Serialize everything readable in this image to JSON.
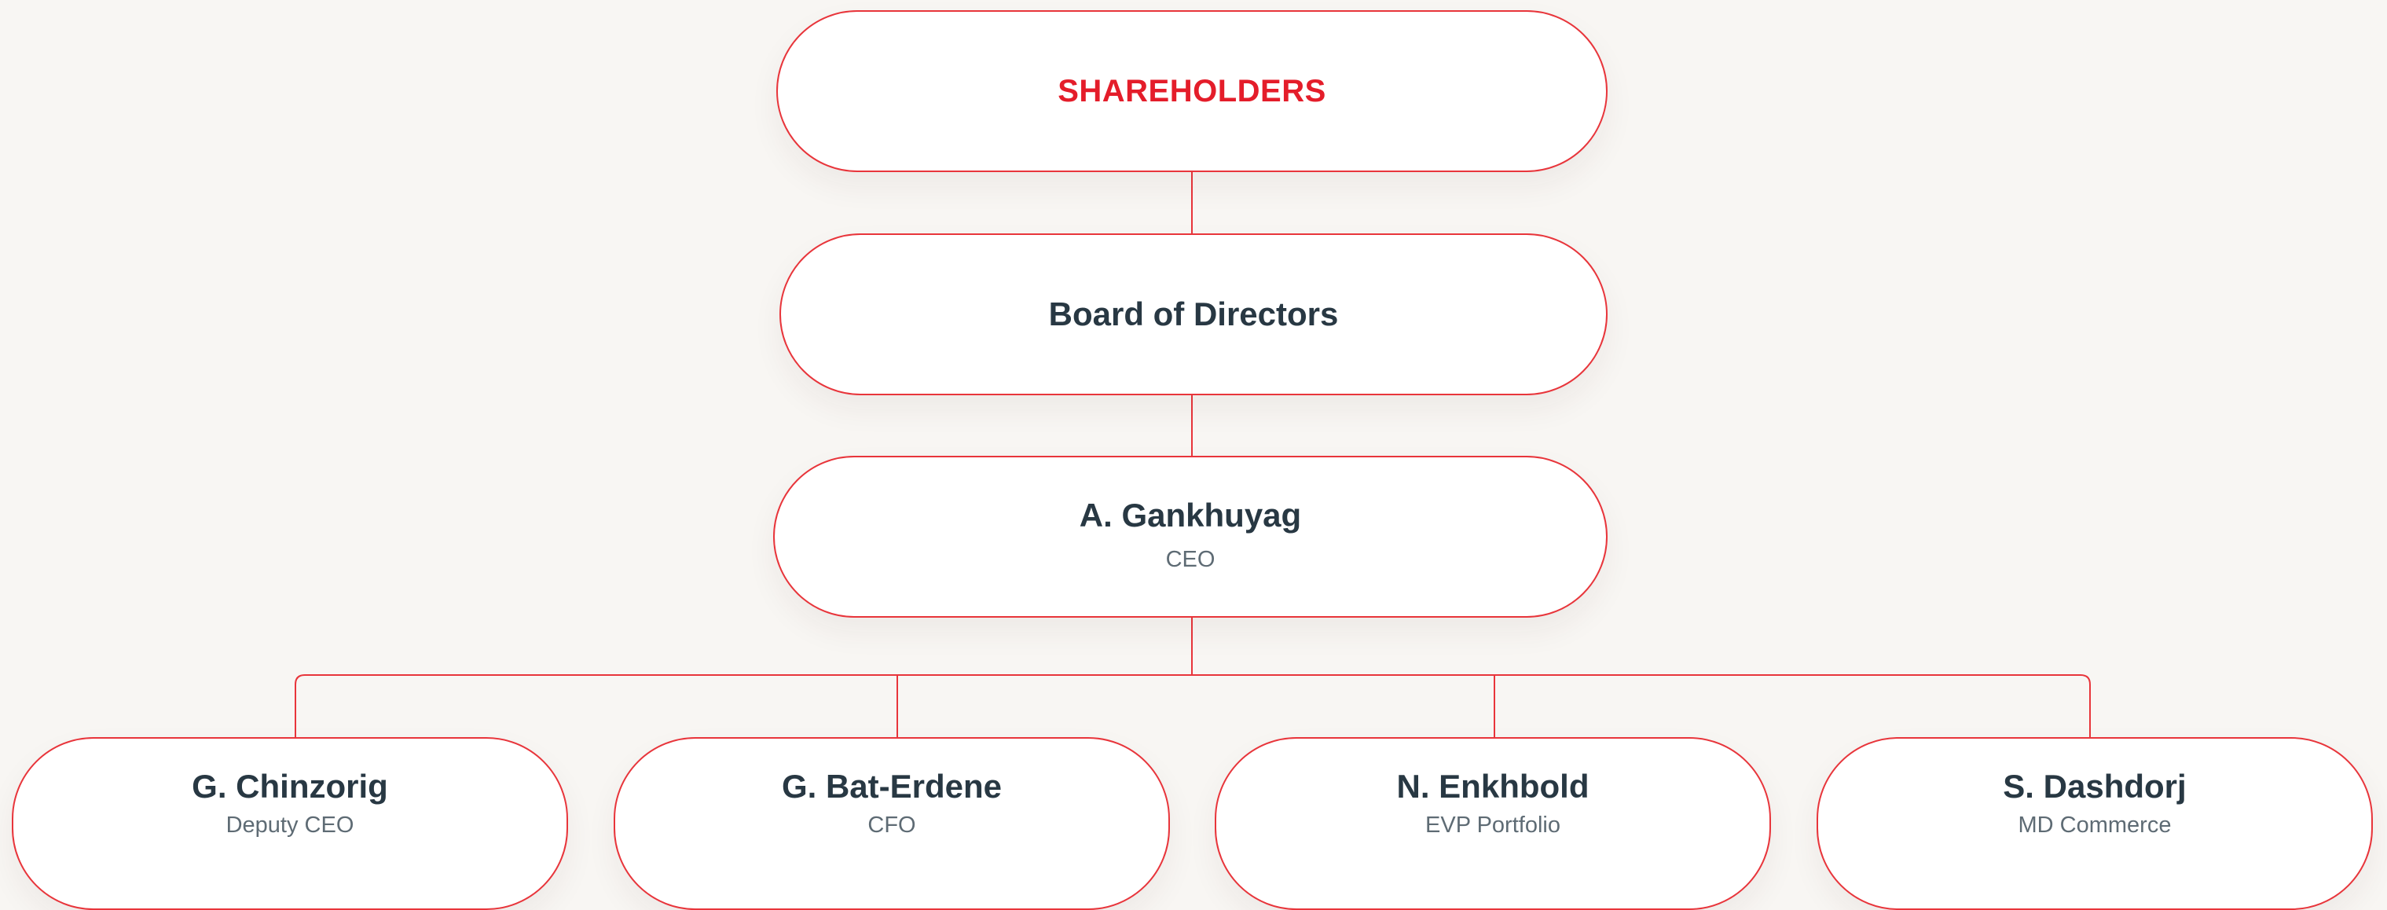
{
  "org_chart": {
    "top": {
      "label": "SHAREHOLDERS"
    },
    "board": {
      "label": "Board of Directors"
    },
    "ceo": {
      "name": "A. Gankhuyag",
      "role": "CEO"
    },
    "reports": [
      {
        "name": "G. Chinzorig",
        "role": "Deputy CEO"
      },
      {
        "name": "G. Bat-Erdene",
        "role": "CFO"
      },
      {
        "name": "N. Enkhbold",
        "role": "EVP Portfolio"
      },
      {
        "name": "S. Dashdorj",
        "role": "MD Commerce"
      }
    ]
  },
  "colors": {
    "accent": "#e41d2a",
    "connector": "#e8353b",
    "text_dark": "#283843",
    "text_muted": "#5e6b74",
    "background": "#f8f6f3",
    "node_fill": "#ffffff"
  }
}
